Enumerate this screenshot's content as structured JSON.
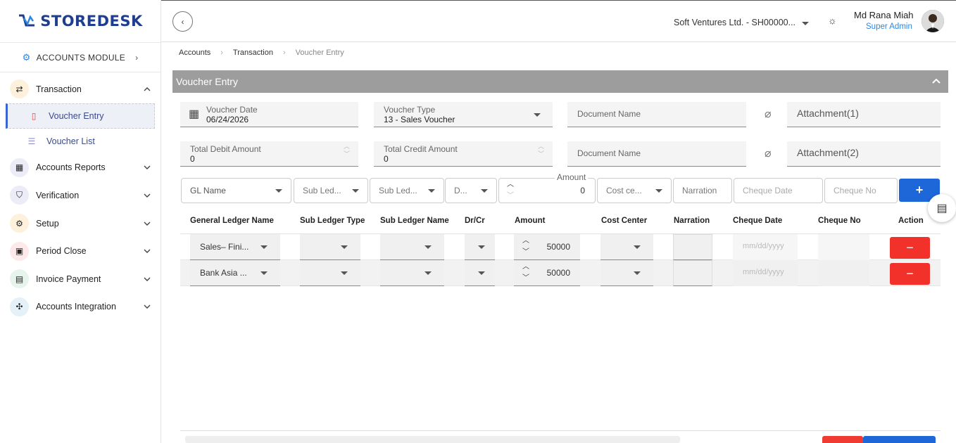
{
  "brand": {
    "logo_text": "STOREDESK"
  },
  "module": {
    "label": "ACCOUNTS MODULE"
  },
  "sidebar": {
    "items": [
      {
        "label": "Transaction",
        "icon": "swap-icon",
        "color": "#fdf1dc"
      },
      {
        "label": "Accounts Reports",
        "icon": "calculator-icon",
        "color": "#ecebf8"
      },
      {
        "label": "Verification",
        "icon": "shield-icon",
        "color": "#ecebf8"
      },
      {
        "label": "Setup",
        "icon": "gear-icon",
        "color": "#fdf1dc"
      },
      {
        "label": "Period Close",
        "icon": "calendar-icon",
        "color": "#fde9ea"
      },
      {
        "label": "Invoice Payment",
        "icon": "invoice-icon",
        "color": "#e6f4ec"
      },
      {
        "label": "Accounts Integration",
        "icon": "plug-icon",
        "color": "#e4f1f8"
      }
    ],
    "sub_items": [
      {
        "label": "Voucher Entry",
        "active": true
      },
      {
        "label": "Voucher List",
        "active": false
      }
    ]
  },
  "header": {
    "company": "Soft Ventures Ltd. - SH00000...",
    "user_name": "Md Rana Miah",
    "user_role": "Super Admin"
  },
  "breadcrumb": [
    "Accounts",
    "Transaction",
    "Voucher Entry"
  ],
  "panel": {
    "title": "Voucher Entry"
  },
  "form": {
    "voucher_date_label": "Voucher Date",
    "voucher_date_value": "06/24/2026",
    "voucher_type_label": "Voucher Type",
    "voucher_type_value": "13 - Sales Voucher",
    "document_name_1": "Document Name",
    "attachment_1": "Attachment(1)",
    "total_debit_label": "Total Debit Amount",
    "total_debit_value": "0",
    "total_credit_label": "Total Credit Amount",
    "total_credit_value": "0",
    "document_name_2": "Document Name",
    "attachment_2": "Attachment(2)"
  },
  "entry": {
    "gl_name": "GL Name",
    "sub_ledger_type": "Sub Led...",
    "sub_ledger_name": "Sub Led...",
    "drcr": "D...",
    "amount_label": "Amount",
    "amount_value": "0",
    "cost_center": "Cost ce...",
    "narration": "Narration",
    "cheque_date": "Cheque Date",
    "cheque_no": "Cheque No",
    "add_label": "+"
  },
  "table": {
    "headers": [
      "General Ledger Name",
      "Sub Ledger Type",
      "Sub Ledger Name",
      "Dr/Cr",
      "Amount",
      "Cost Center",
      "Narration",
      "Cheque Date",
      "Cheque No",
      "Action"
    ],
    "rows": [
      {
        "gl": "Sales– Fini...",
        "amount": "50000",
        "cheque_date": "mm/dd/yyyy",
        "action": "−"
      },
      {
        "gl": "Bank Asia ...",
        "amount": "50000",
        "cheque_date": "mm/dd/yyyy",
        "action": "−"
      }
    ]
  }
}
